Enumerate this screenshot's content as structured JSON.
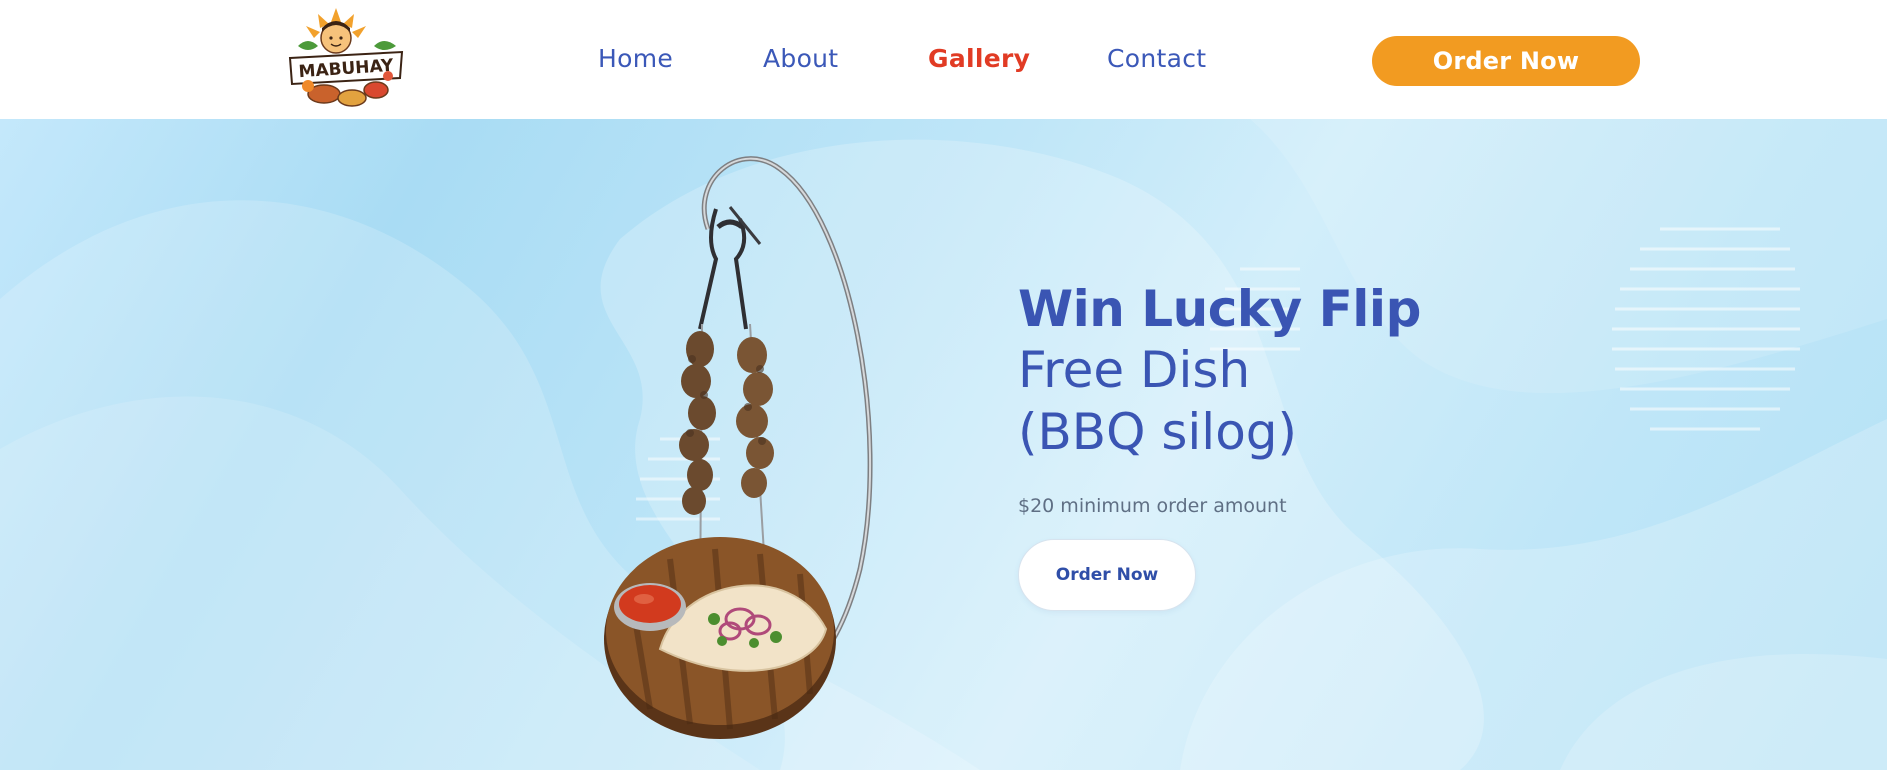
{
  "header": {
    "logo_alt": "MABUHAY",
    "nav": [
      {
        "label": "Home",
        "active": false
      },
      {
        "label": "About",
        "active": false
      },
      {
        "label": "Gallery",
        "active": true
      },
      {
        "label": "Contact",
        "active": false
      }
    ],
    "cta_label": "Order Now"
  },
  "hero": {
    "title": "Win Lucky Flip",
    "subtitle_line1": "Free Dish",
    "subtitle_line2": "(BBQ silog)",
    "note": "$20 minimum order amount",
    "cta_label": "Order Now",
    "image_desc": "Hanging BBQ skewers over wooden board with sauce and salad"
  },
  "colors": {
    "brand_blue": "#3a55b3",
    "active_red": "#e13b24",
    "cta_orange": "#f29b21",
    "hero_bg": "#bfe6f8"
  },
  "icons": [
    "logo-mabuhay",
    "skewer-dish-image"
  ]
}
